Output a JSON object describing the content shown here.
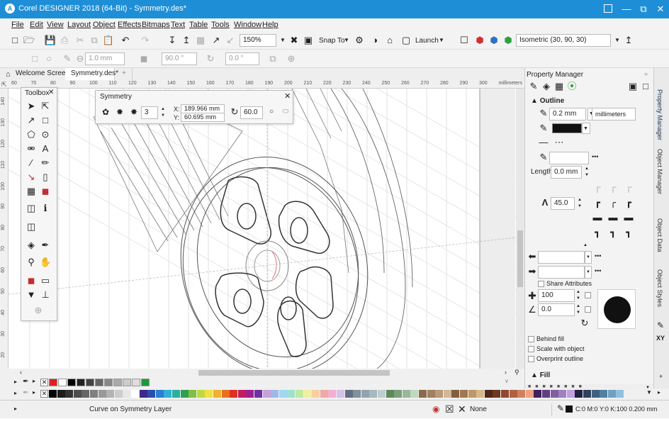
{
  "window": {
    "title": "Corel DESIGNER 2018 (64-Bit) - Symmetry.des*",
    "app_icon": "corel-logo-icon"
  },
  "menu": [
    "File",
    "Edit",
    "View",
    "Layout",
    "Object",
    "Effects",
    "Bitmaps",
    "Text",
    "Table",
    "Tools",
    "Window",
    "Help"
  ],
  "toolbar": {
    "zoom": "150%",
    "snap_label": "Snap To",
    "launch_label": "Launch",
    "projection": "Isometric (30, 90, 30)"
  },
  "propbar": {
    "outline_width": "1.0 mm",
    "angle1": "90.0 °",
    "angle2": "0.0 °"
  },
  "tabs": {
    "welcome": "Welcome Screen",
    "document": "Symmetry.des*",
    "add": "+"
  },
  "ruler": {
    "top": [
      "60",
      "70",
      "80",
      "90",
      "100",
      "110",
      "120",
      "130",
      "140",
      "150",
      "160",
      "170",
      "180",
      "190",
      "200",
      "210",
      "220",
      "230",
      "240",
      "250",
      "260",
      "270",
      "280",
      "290",
      "300",
      "millimeters"
    ],
    "left": [
      "140",
      "130",
      "120",
      "110",
      "100",
      "90",
      "80",
      "70",
      "60",
      "50",
      "40",
      "30",
      "20"
    ]
  },
  "toolbox": {
    "title": "Toolbox",
    "close": "✕"
  },
  "symmetry": {
    "title": "Symmetry",
    "close": "✕",
    "count": "3",
    "x": "189.966 mm",
    "y": "60.695 mm",
    "x_label": "X:",
    "y_label": "Y:",
    "angle": "60.0"
  },
  "property_manager": {
    "title": "Property Manager",
    "outline_section": "Outline",
    "width": "0.2 mm",
    "units": "millimeters",
    "length_label": "Length:",
    "length": "0.0 mm",
    "miter": "45.0",
    "share_attributes": "Share Attributes",
    "stretch": "100",
    "angle": "0.0",
    "behind_fill": "Behind fill",
    "scale_with_object": "Scale with object",
    "overprint_outline": "Overprint outline",
    "fill_section": "Fill",
    "more": "•••"
  },
  "side_tabs": [
    "Property Manager",
    "Object Manager",
    "Object Data",
    "Object Styles"
  ],
  "side_tab_xy": "XY",
  "status": {
    "text": "Curve on Symmetry Layer",
    "fill": "None",
    "outline": "C:0 M:0 Y:0 K:100  0.200 mm"
  },
  "colors": {
    "accent": "#1e8fd7",
    "doc_palette": [
      "#e02020",
      "#ffffff",
      "#000000",
      "#222222",
      "#444444",
      "#666666",
      "#888888",
      "#aaaaaa",
      "#cccccc",
      "#dddddd",
      "#1a9a3a"
    ],
    "palette": [
      "#000000",
      "#1c1c1c",
      "#333333",
      "#4d4d4d",
      "#666666",
      "#808080",
      "#999999",
      "#b3b3b3",
      "#cccccc",
      "#e6e6e6",
      "#ffffff",
      "#3a2a8a",
      "#2a4db0",
      "#2a7fd0",
      "#30b0d8",
      "#28b0a0",
      "#30a050",
      "#80c040",
      "#c0d840",
      "#f0e040",
      "#f0b030",
      "#e87020",
      "#e03020",
      "#c02060",
      "#a02090",
      "#7030a0",
      "#c8a0d8",
      "#a0b8e8",
      "#a0d8f0",
      "#a0e0d0",
      "#c0e8a0",
      "#f0f0a0",
      "#f8d0a0",
      "#f0a8a8",
      "#f0b0d0",
      "#d8c0e8",
      "#607080",
      "#80909c",
      "#90a4b0",
      "#a8b8c0",
      "#c0ccd0",
      "#5a8a5a",
      "#7aa07a",
      "#9ab89a",
      "#c0d8c0",
      "#8a6a4a",
      "#a08060",
      "#b89a78",
      "#d0b898",
      "#806040",
      "#a07850",
      "#c09868",
      "#d8b888",
      "#502818",
      "#703820",
      "#904830",
      "#b06040",
      "#d08060",
      "#f0a080",
      "#402060",
      "#604080",
      "#8060a0",
      "#a080c0",
      "#c0a0e0",
      "#202040",
      "#304060",
      "#406080",
      "#5080a0",
      "#70a0c0",
      "#90c0e0"
    ]
  }
}
